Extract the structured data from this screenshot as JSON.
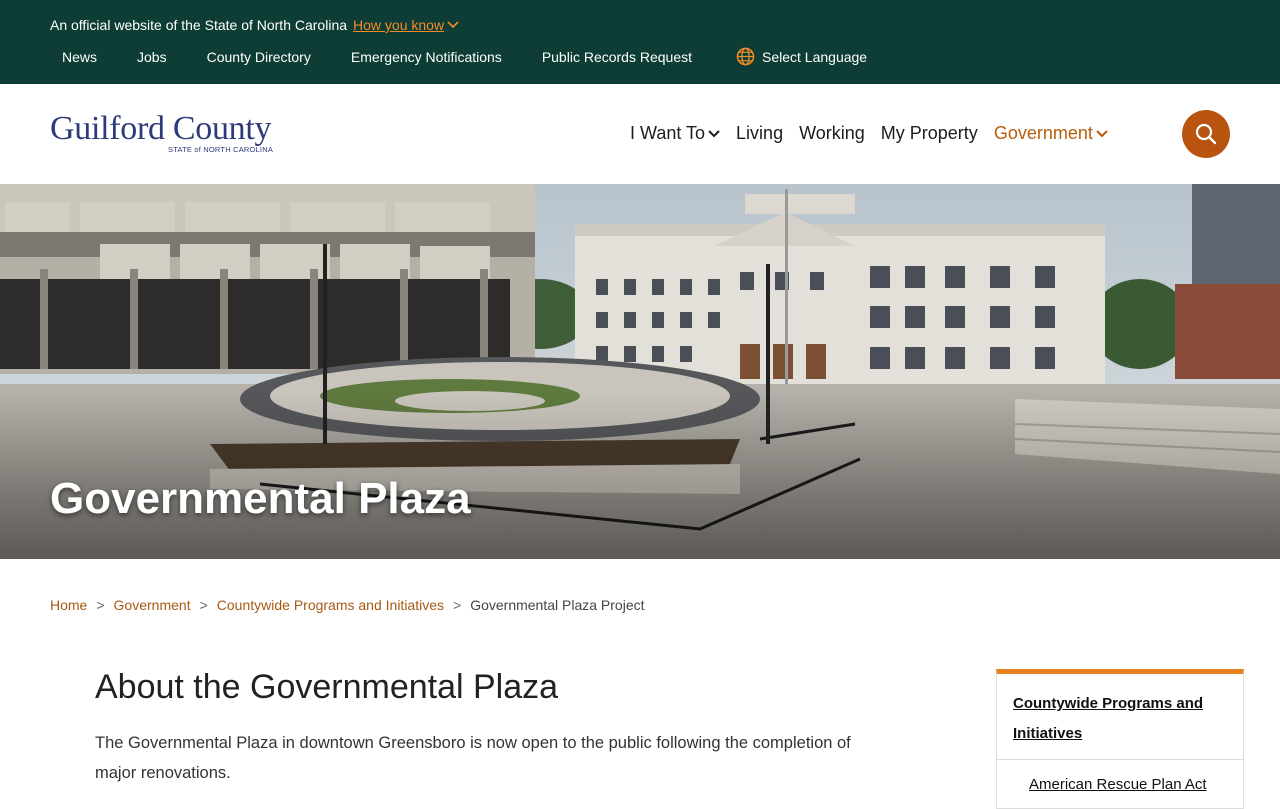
{
  "banner": {
    "official_text": "An official website of the State of North Carolina",
    "how_you_know": "How you know"
  },
  "topnav": {
    "items": [
      "News",
      "Jobs",
      "County Directory",
      "Emergency Notifications",
      "Public Records Request"
    ],
    "language": "Select Language"
  },
  "logo": {
    "name": "Guilford County",
    "subtitle": "STATE of NORTH CAROLINA"
  },
  "mainnav": {
    "items": [
      "I Want To",
      "Living",
      "Working",
      "My Property",
      "Government"
    ],
    "active": "Government"
  },
  "hero": {
    "title": "Governmental Plaza"
  },
  "breadcrumb": {
    "items": [
      "Home",
      "Government",
      "Countywide Programs and Initiatives"
    ],
    "current": "Governmental Plaza Project",
    "separator": ">"
  },
  "main": {
    "heading": "About the Governmental Plaza",
    "paragraph": "The Governmental Plaza in downtown Greensboro is now open to the public following the completion of major renovations."
  },
  "sidebar": {
    "heading": "Countywide Programs and Initiatives",
    "links": [
      "American Rescue Plan Act"
    ]
  },
  "colors": {
    "topbar": "#0d3d35",
    "accent_orange": "#b85410",
    "link_orange": "#a65a12",
    "sidebar_border": "#e8801f"
  }
}
